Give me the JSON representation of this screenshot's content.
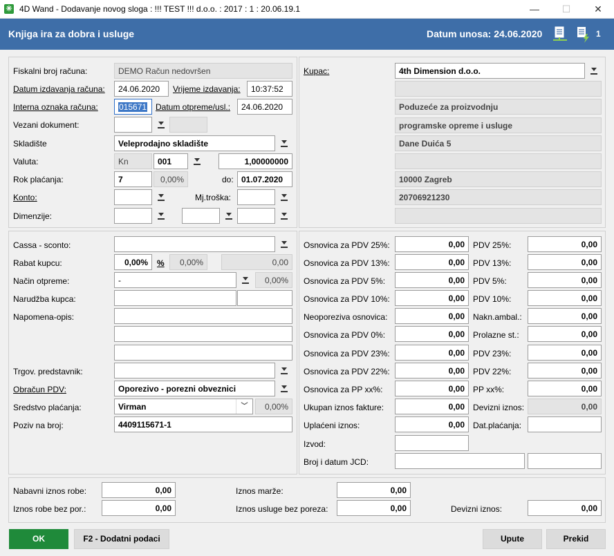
{
  "window": {
    "title": "4D Wand - Dodavanje novog sloga : !!! TEST !!! d.o.o. : 2017 : 1 : 20.06.19.1",
    "minimize": "—",
    "maximize": "☐",
    "close": "✕"
  },
  "header": {
    "title": "Knjiga ira za dobra i usluge",
    "date": "Datum unosa: 24.06.2020",
    "badge": "1"
  },
  "left": {
    "fiskalni_label": "Fiskalni broj računa:",
    "fiskalni_value": "DEMO Račun nedovršen",
    "datum_izd_label": "Datum izdavanja računa:",
    "datum_izd_value": "24.06.2020",
    "vrijeme_label": "Vrijeme izdavanja:",
    "vrijeme_value": "10:37:52",
    "interna_label": "Interna oznaka računa:",
    "interna_value": "015671",
    "datum_otp_label": "Datum otpreme/usl.:",
    "datum_otp_value": "24.06.2020",
    "vezani_label": "Vezani dokument:",
    "skladiste_label": "Skladište",
    "skladiste_value": "Veleprodajno skladište",
    "valuta_label": "Valuta:",
    "valuta_code": "Kn",
    "valuta_num": "001",
    "valuta_rate": "1,00000000",
    "rok_label": "Rok plaćanja:",
    "rok_days": "7",
    "rok_pct": "0,00%",
    "do_label": "do:",
    "rok_date": "01.07.2020",
    "konto_label": "Konto:",
    "mj_label": "Mj.troška:",
    "dimenzije_label": "Dimenzije:"
  },
  "right": {
    "kupac_label": "Kupac:",
    "kupac_value": "4th Dimension d.o.o.",
    "line1": "",
    "line2": "Poduzeće za proizvodnju",
    "line3": "programske opreme i usluge",
    "line4": "Dane Duića 5",
    "line5": "",
    "line6": "10000 Zagreb",
    "line7": "20706921230",
    "line8": ""
  },
  "mid_left": {
    "cassa_label": "Cassa - sconto:",
    "rabat_label": "Rabat kupcu:",
    "rabat_pct": "0,00%",
    "pct_symbol": "%",
    "rabat_pct2": "0,00%",
    "rabat_amt": "0,00",
    "nacin_label": "Način otpreme:",
    "nacin_value": "-",
    "nacin_pct": "0,00%",
    "narudzba_label": "Narudžba kupca:",
    "napomena_label": "Napomena-opis:",
    "trgov_label": "Trgov. predstavnik:",
    "obracun_label": "Obračun PDV:",
    "obracun_value": "Oporezivo - porezni obveznici",
    "sredstvo_label": "Sredstvo plaćanja:",
    "sredstvo_value": "Virman",
    "sredstvo_pct": "0,00%",
    "poziv_label": "Poziv na broj:",
    "poziv_value": "4409115671-1"
  },
  "mid_right": {
    "rows": [
      {
        "label": "Osnovica za PDV 25%:",
        "value": "0,00",
        "label2": "PDV 25%:",
        "value2": "0,00"
      },
      {
        "label": "Osnovica za PDV 13%:",
        "value": "0,00",
        "label2": "PDV 13%:",
        "value2": "0,00"
      },
      {
        "label": "Osnovica za PDV 5%:",
        "value": "0,00",
        "label2": "PDV 5%:",
        "value2": "0,00"
      },
      {
        "label": "Osnovica za PDV 10%:",
        "value": "0,00",
        "label2": "PDV 10%:",
        "value2": "0,00"
      },
      {
        "label": "Neoporeziva osnovica:",
        "value": "0,00",
        "label2": "Nakn.ambal.:",
        "value2": "0,00"
      },
      {
        "label": "Osnovica za PDV 0%:",
        "value": "0,00",
        "label2": "Prolazne st.:",
        "value2": "0,00"
      },
      {
        "label": "Osnovica za PDV 23%:",
        "value": "0,00",
        "label2": "PDV 23%:",
        "value2": "0,00"
      },
      {
        "label": "Osnovica za PDV 22%:",
        "value": "0,00",
        "label2": "PDV 22%:",
        "value2": "0,00"
      },
      {
        "label": "Osnovica za PP xx%:",
        "value": "0,00",
        "label2": "PP xx%:",
        "value2": "0,00"
      },
      {
        "label": "Ukupan iznos fakture:",
        "value": "0,00",
        "label2": "Devizni iznos:",
        "value2": "0,00"
      },
      {
        "label": "Uplaćeni iznos:",
        "value": "0,00",
        "label2": "Dat.plaćanja:",
        "value2": ""
      }
    ],
    "izvod_label": "Izvod:",
    "jcd_label": "Broj i datum JCD:"
  },
  "bottom": {
    "nabavni_label": "Nabavni iznos robe:",
    "nabavni_value": "0,00",
    "robe_label": "Iznos robe bez por.:",
    "robe_value": "0,00",
    "marze_label": "Iznos marže:",
    "marze_value": "0,00",
    "usluge_label": "Iznos usluge bez poreza:",
    "usluge_value": "0,00",
    "devizni_label": "Devizni iznos:",
    "devizni_value": "0,00"
  },
  "buttons": {
    "ok": "OK",
    "dodatni": "F2 - Dodatni podaci",
    "upute": "Upute",
    "prekid": "Prekid"
  }
}
